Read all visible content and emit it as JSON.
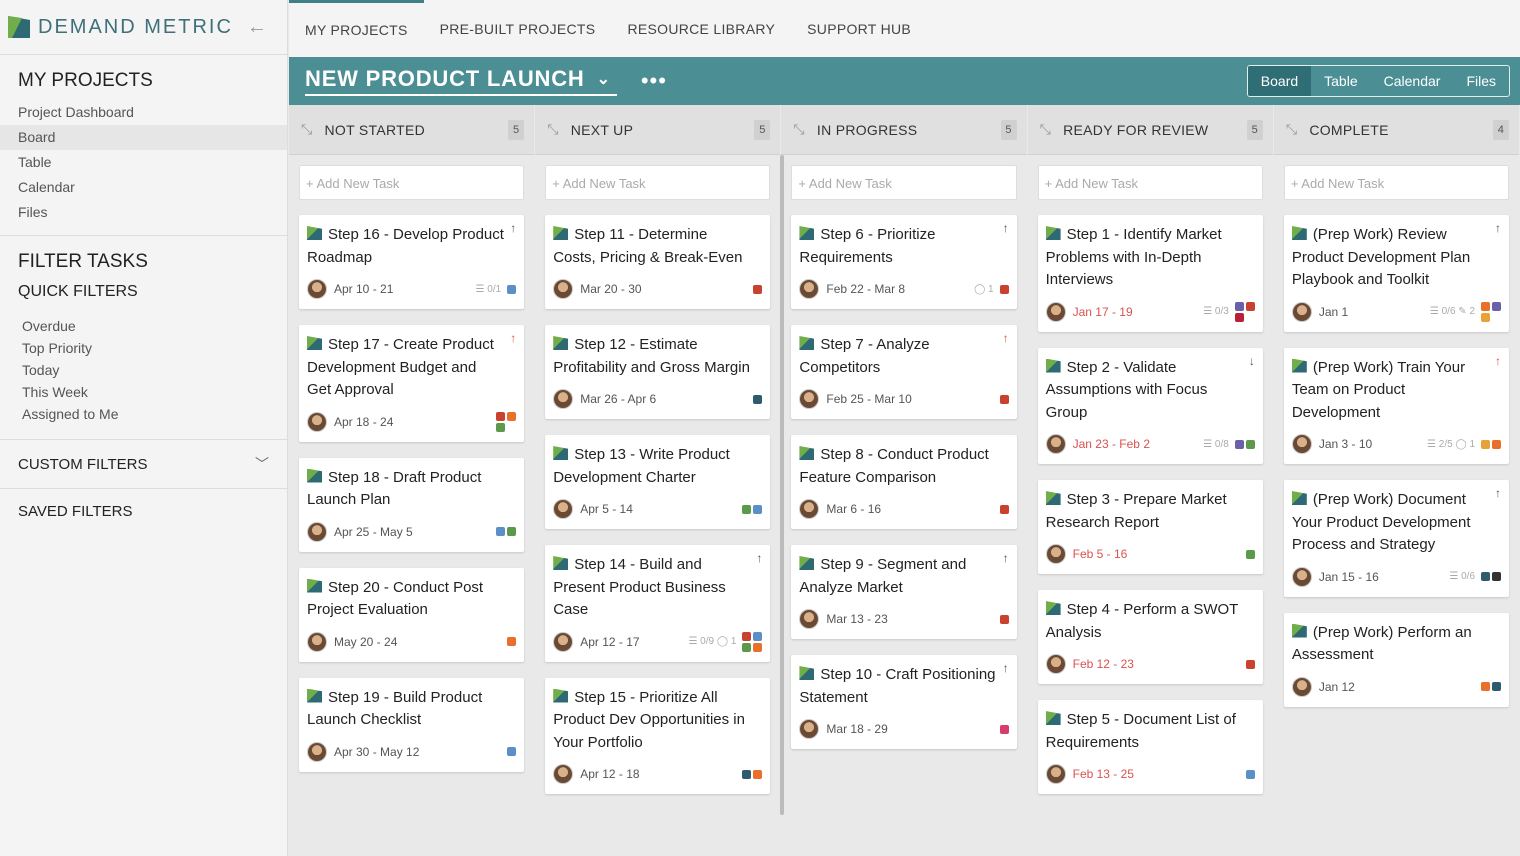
{
  "brand": {
    "name": "DEMAND METRIC"
  },
  "sidebar": {
    "my_projects": "MY PROJECTS",
    "links": [
      "Project Dashboard",
      "Board",
      "Table",
      "Calendar",
      "Files"
    ],
    "filter_tasks": "FILTER TASKS",
    "quick_filters": "QUICK FILTERS",
    "filters": [
      "Overdue",
      "Top Priority",
      "Today",
      "This Week",
      "Assigned to Me"
    ],
    "custom_filters": "CUSTOM FILTERS",
    "saved_filters": "SAVED FILTERS"
  },
  "topnav": [
    "MY PROJECTS",
    "PRE-BUILT PROJECTS",
    "RESOURCE LIBRARY",
    "SUPPORT HUB"
  ],
  "project": {
    "title": "NEW PRODUCT LAUNCH",
    "more": "•••",
    "views": [
      "Board",
      "Table",
      "Calendar",
      "Files"
    ]
  },
  "add_task": "+ Add New Task",
  "colors": {
    "orange": "#e8702a",
    "blue": "#5b8fc7",
    "green": "#5a9a4a",
    "red": "#c9412f",
    "navy": "#2e5c6e",
    "purple": "#6a5fa8",
    "pink": "#d63d6a",
    "teal": "#3e8a8a",
    "yellow": "#e8a23a",
    "black": "#333333",
    "crimson": "#b8203a"
  },
  "columns": [
    {
      "name": "NOT STARTED",
      "count": "5",
      "cards": [
        {
          "title": "Step 16 - Develop Product Roadmap",
          "prio": "↑",
          "date": "Apr 10 - 21",
          "stats": "☰ 0/1",
          "tags": [
            "blue"
          ]
        },
        {
          "title": "Step 17 - Create Product Development Budget and Get Approval",
          "prio": "↑",
          "prio_red": true,
          "date": "Apr 18 - 24",
          "tags": [
            "red",
            "orange",
            "green"
          ]
        },
        {
          "title": "Step 18 - Draft Product Launch Plan",
          "date": "Apr 25 - May 5",
          "tags": [
            "blue",
            "green"
          ]
        },
        {
          "title": "Step 20 - Conduct Post Project Evaluation",
          "date": "May 20 - 24",
          "tags": [
            "orange"
          ]
        },
        {
          "title": "Step 19 - Build Product Launch Checklist",
          "date": "Apr 30 - May 12",
          "tags": [
            "blue"
          ]
        }
      ]
    },
    {
      "name": "NEXT UP",
      "count": "5",
      "cards": [
        {
          "title": "Step 11 - Determine Costs, Pricing & Break-Even",
          "date": "Mar 20 - 30",
          "tags": [
            "red"
          ]
        },
        {
          "title": "Step 12 - Estimate Profitability and Gross Margin",
          "date": "Mar 26 - Apr 6",
          "tags": [
            "navy"
          ]
        },
        {
          "title": "Step 13 - Write Product Development Charter",
          "date": "Apr 5 - 14",
          "tags": [
            "green",
            "blue"
          ]
        },
        {
          "title": "Step 14 - Build and Present Product Business Case",
          "prio": "↑",
          "date": "Apr 12 - 17",
          "stats": "☰ 0/9  ◯ 1",
          "tags": [
            "red",
            "blue",
            "green",
            "orange"
          ]
        },
        {
          "title": "Step 15 - Prioritize All Product Dev Opportunities in Your Portfolio",
          "date": "Apr 12 - 18",
          "tags": [
            "navy",
            "orange"
          ]
        }
      ]
    },
    {
      "name": "IN PROGRESS",
      "count": "5",
      "cards": [
        {
          "title": "Step 6 - Prioritize Requirements",
          "prio": "↑",
          "date": "Feb 22 - Mar 8",
          "stats": "◯ 1",
          "tags": [
            "red"
          ]
        },
        {
          "title": "Step 7 - Analyze Competitors",
          "prio": "↑",
          "prio_red": true,
          "date": "Feb 25 - Mar 10",
          "tags": [
            "red"
          ]
        },
        {
          "title": "Step 8 - Conduct Product Feature Comparison",
          "date": "Mar 6 - 16",
          "tags": [
            "red"
          ]
        },
        {
          "title": "Step 9 - Segment and Analyze Market",
          "prio": "↑",
          "date": "Mar 13 - 23",
          "tags": [
            "red"
          ]
        },
        {
          "title": "Step 10 - Craft Positioning Statement",
          "prio": "↑",
          "date": "Mar 18 - 29",
          "tags": [
            "pink"
          ]
        }
      ]
    },
    {
      "name": "READY FOR REVIEW",
      "count": "5",
      "cards": [
        {
          "title": "Step 1 - Identify Market Problems with In-Depth Interviews",
          "date": "Jan 17 - 19",
          "late": true,
          "stats": "☰ 0/3",
          "tags": [
            "purple",
            "red",
            "crimson"
          ]
        },
        {
          "title": "Step 2 - Validate Assumptions with Focus Group",
          "prio": "↓",
          "date": "Jan 23 - Feb 2",
          "late": true,
          "stats": "☰ 0/8",
          "tags": [
            "purple",
            "green"
          ]
        },
        {
          "title": "Step 3 - Prepare Market Research Report",
          "date": "Feb 5 - 16",
          "late": true,
          "tags": [
            "green"
          ]
        },
        {
          "title": "Step 4 - Perform a SWOT Analysis",
          "date": "Feb 12 - 23",
          "late": true,
          "tags": [
            "red"
          ]
        },
        {
          "title": "Step 5 - Document List of Requirements",
          "date": "Feb 13 - 25",
          "late": true,
          "tags": [
            "blue"
          ]
        }
      ]
    },
    {
      "name": "COMPLETE",
      "count": "4",
      "cards": [
        {
          "title": "(Prep Work) Review Product Development Plan Playbook and Toolkit",
          "prio": "↑",
          "date": "Jan 1",
          "stats": "☰ 0/6  ✎ 2",
          "tags": [
            "orange",
            "purple",
            "yellow"
          ]
        },
        {
          "title": "(Prep Work) Train Your Team on Product Development",
          "prio": "↑",
          "prio_red": true,
          "date": "Jan 3 - 10",
          "stats": "☰ 2/5  ◯ 1",
          "tags": [
            "yellow",
            "orange"
          ]
        },
        {
          "title": "(Prep Work) Document Your Product Development Process and Strategy",
          "prio": "↑",
          "date": "Jan 15 - 16",
          "stats": "☰ 0/6",
          "tags": [
            "navy",
            "black"
          ]
        },
        {
          "title": "(Prep Work) Perform an Assessment",
          "date": "Jan 12",
          "tags": [
            "orange",
            "navy"
          ]
        }
      ]
    }
  ]
}
